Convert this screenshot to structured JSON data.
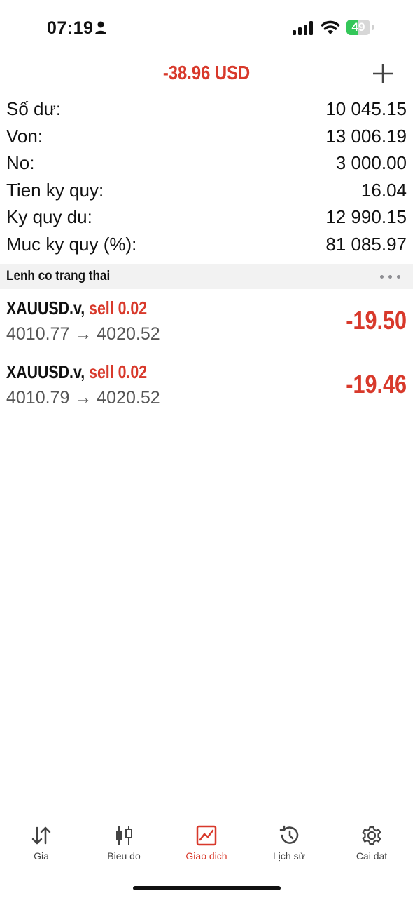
{
  "status_bar": {
    "time": "07:19",
    "battery_level": 49,
    "battery_text": "49",
    "battery_color": "#34c759"
  },
  "header": {
    "total_profit": "-38.96 USD",
    "add_icon": "plus-icon"
  },
  "summary": [
    {
      "label": "Số dư:",
      "value": "10 045.15"
    },
    {
      "label": "Von:",
      "value": "13 006.19"
    },
    {
      "label": "No:",
      "value": "3 000.00"
    },
    {
      "label": "Tien ky quy:",
      "value": "16.04"
    },
    {
      "label": "Ky quy du:",
      "value": "12 990.15"
    },
    {
      "label": "Muc ky quy (%):",
      "value": "81 085.97"
    }
  ],
  "positions_section": {
    "title": "Lenh co trang thai",
    "more_icon": "ellipsis-icon"
  },
  "positions": [
    {
      "symbol": "XAUUSD.v,",
      "type": "sell 0.02",
      "open_price": "4010.77",
      "arrow": "→",
      "current_price": "4020.52",
      "profit": "-19.50"
    },
    {
      "symbol": "XAUUSD.v,",
      "type": "sell 0.02",
      "open_price": "4010.79",
      "arrow": "→",
      "current_price": "4020.52",
      "profit": "-19.46"
    }
  ],
  "tabs": [
    {
      "label": "Gia",
      "icon": "quotes-arrows-icon",
      "active": false
    },
    {
      "label": "Bieu do",
      "icon": "candlestick-icon",
      "active": false
    },
    {
      "label": "Giao dich",
      "icon": "trade-chart-icon",
      "active": true
    },
    {
      "label": "Lịch sử",
      "icon": "history-icon",
      "active": false
    },
    {
      "label": "Cai dat",
      "icon": "gear-icon",
      "active": false
    }
  ],
  "colors": {
    "accent_red": "#d8392b",
    "section_bg": "#f2f2f2",
    "muted_text": "#555555"
  }
}
